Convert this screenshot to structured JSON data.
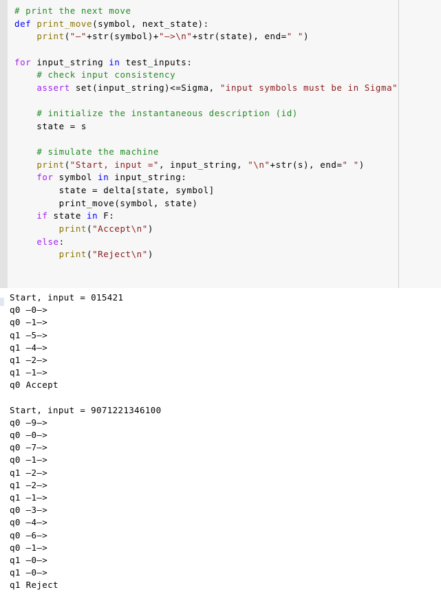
{
  "notebook": {
    "code_cell": {
      "language": "python",
      "background_color": "#f7f7f7",
      "gutter_color": "#e3e3e3",
      "border_color": "#cfcfcf",
      "token_colors": {
        "comment": "#268b26",
        "keyword": "#a020f0",
        "keyword_alt": "#0000ff",
        "function": "#8b7500",
        "string": "#8b1a1a",
        "text": "#000000"
      },
      "lines": [
        [
          {
            "t": "# print the next move",
            "c": "com"
          }
        ],
        [
          {
            "t": "def ",
            "c": "kw2"
          },
          {
            "t": "print_move",
            "c": "fn"
          },
          {
            "t": "(symbol, next_state):",
            "c": "txt"
          }
        ],
        [
          {
            "t": "    ",
            "c": "txt"
          },
          {
            "t": "print",
            "c": "fn"
          },
          {
            "t": "(",
            "c": "txt"
          },
          {
            "t": "\"—\"",
            "c": "str"
          },
          {
            "t": "+str(symbol)+",
            "c": "txt"
          },
          {
            "t": "\"—>\\n\"",
            "c": "str"
          },
          {
            "t": "+str(state), end=",
            "c": "txt"
          },
          {
            "t": "\" \"",
            "c": "str"
          },
          {
            "t": ")",
            "c": "txt"
          }
        ],
        [],
        [
          {
            "t": "for ",
            "c": "kw"
          },
          {
            "t": "input_string ",
            "c": "txt"
          },
          {
            "t": "in ",
            "c": "kw2"
          },
          {
            "t": "test_inputs:",
            "c": "txt"
          }
        ],
        [
          {
            "t": "    ",
            "c": "txt"
          },
          {
            "t": "# check input consistency",
            "c": "com"
          }
        ],
        [
          {
            "t": "    ",
            "c": "txt"
          },
          {
            "t": "assert ",
            "c": "kw"
          },
          {
            "t": "set(input_string)<=Sigma, ",
            "c": "txt"
          },
          {
            "t": "\"input symbols must be in Sigma\"",
            "c": "str"
          }
        ],
        [],
        [
          {
            "t": "    ",
            "c": "txt"
          },
          {
            "t": "# initialize the instantaneous description (id)",
            "c": "com"
          }
        ],
        [
          {
            "t": "    state = s",
            "c": "txt"
          }
        ],
        [],
        [
          {
            "t": "    ",
            "c": "txt"
          },
          {
            "t": "# simulate the machine",
            "c": "com"
          }
        ],
        [
          {
            "t": "    ",
            "c": "txt"
          },
          {
            "t": "print",
            "c": "fn"
          },
          {
            "t": "(",
            "c": "txt"
          },
          {
            "t": "\"Start, input =\"",
            "c": "str"
          },
          {
            "t": ", input_string, ",
            "c": "txt"
          },
          {
            "t": "\"\\n\"",
            "c": "str"
          },
          {
            "t": "+str(s), end=",
            "c": "txt"
          },
          {
            "t": "\" \"",
            "c": "str"
          },
          {
            "t": ")",
            "c": "txt"
          }
        ],
        [
          {
            "t": "    ",
            "c": "txt"
          },
          {
            "t": "for ",
            "c": "kw"
          },
          {
            "t": "symbol ",
            "c": "txt"
          },
          {
            "t": "in ",
            "c": "kw2"
          },
          {
            "t": "input_string:",
            "c": "txt"
          }
        ],
        [
          {
            "t": "        state = delta[state, symbol]",
            "c": "txt"
          }
        ],
        [
          {
            "t": "        print_move(symbol, state)",
            "c": "txt"
          }
        ],
        [
          {
            "t": "    ",
            "c": "txt"
          },
          {
            "t": "if ",
            "c": "kw"
          },
          {
            "t": "state ",
            "c": "txt"
          },
          {
            "t": "in ",
            "c": "kw2"
          },
          {
            "t": "F:",
            "c": "txt"
          }
        ],
        [
          {
            "t": "        ",
            "c": "txt"
          },
          {
            "t": "print",
            "c": "fn"
          },
          {
            "t": "(",
            "c": "txt"
          },
          {
            "t": "\"Accept\\n\"",
            "c": "str"
          },
          {
            "t": ")",
            "c": "txt"
          }
        ],
        [
          {
            "t": "    ",
            "c": "txt"
          },
          {
            "t": "else",
            "c": "kw"
          },
          {
            "t": ":",
            "c": "txt"
          }
        ],
        [
          {
            "t": "        ",
            "c": "txt"
          },
          {
            "t": "print",
            "c": "fn"
          },
          {
            "t": "(",
            "c": "txt"
          },
          {
            "t": "\"Reject\\n\"",
            "c": "str"
          },
          {
            "t": ")",
            "c": "txt"
          }
        ]
      ]
    },
    "output_cell": {
      "background_color": "#ffffff",
      "prompt_marker_color": "#dfe7f3",
      "lines": [
        "Start, input = 015421",
        "q0 —0—>",
        "q0 —1—>",
        "q1 —5—>",
        "q1 —4—>",
        "q1 —2—>",
        "q1 —1—>",
        "q0 Accept",
        "",
        "Start, input = 9071221346100",
        "q0 —9—>",
        "q0 —0—>",
        "q0 —7—>",
        "q0 —1—>",
        "q1 —2—>",
        "q1 —2—>",
        "q1 —1—>",
        "q0 —3—>",
        "q0 —4—>",
        "q0 —6—>",
        "q0 —1—>",
        "q1 —0—>",
        "q1 —0—>",
        "q1 Reject"
      ]
    }
  }
}
